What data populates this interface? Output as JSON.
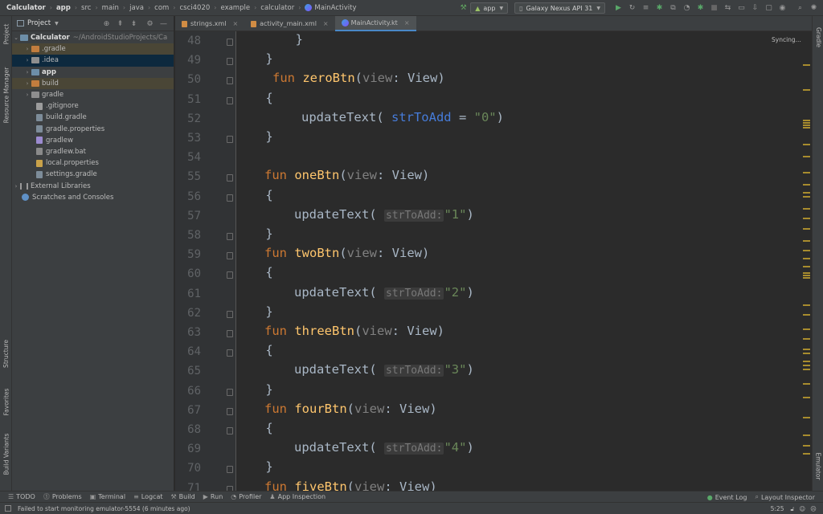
{
  "breadcrumbs": [
    "Calculator",
    "app",
    "src",
    "main",
    "java",
    "com",
    "csci4020",
    "example",
    "calculator",
    "MainActivity"
  ],
  "toolbar": {
    "run_config": "app",
    "device": "Galaxy Nexus API 31"
  },
  "left_tool_tabs": [
    "Project",
    "Resource Manager",
    "Structure",
    "Favorites",
    "Build Variants"
  ],
  "right_tool_tabs": [
    "Gradle",
    "Emulator"
  ],
  "project_panel": {
    "title": "Project",
    "root_name": "Calculator",
    "root_path": "~/AndroidStudioProjects/Ca",
    "items": [
      {
        "label": ".gradle"
      },
      {
        "label": ".idea"
      },
      {
        "label": "app"
      },
      {
        "label": "build"
      },
      {
        "label": "gradle"
      },
      {
        "label": ".gitignore"
      },
      {
        "label": "build.gradle"
      },
      {
        "label": "gradle.properties"
      },
      {
        "label": "gradlew"
      },
      {
        "label": "gradlew.bat"
      },
      {
        "label": "local.properties"
      },
      {
        "label": "settings.gradle"
      },
      {
        "label": "External Libraries"
      },
      {
        "label": "Scratches and Consoles"
      }
    ]
  },
  "editor_tabs": [
    {
      "label": "strings.xml"
    },
    {
      "label": "activity_main.xml"
    },
    {
      "label": "MainActivity.kt"
    }
  ],
  "editor_status": "Syncing...",
  "code_lines": [
    {
      "n": "48",
      "text": "        }"
    },
    {
      "n": "49",
      "text": "    }"
    },
    {
      "n": "50",
      "kw": "fun",
      "fn": "zeroBtn",
      "param": "view",
      "type": "View"
    },
    {
      "n": "51",
      "text": "    {"
    },
    {
      "n": "52",
      "call": "updateText(",
      "named": "strToAdd",
      "eq": " = ",
      "str": "\"0\"",
      "close": ")"
    },
    {
      "n": "53",
      "text": "    }"
    },
    {
      "n": "54",
      "text": ""
    },
    {
      "n": "55",
      "kw": "fun",
      "fn": "oneBtn",
      "param": "view",
      "type": "View"
    },
    {
      "n": "56",
      "text": "    {"
    },
    {
      "n": "57",
      "call": "updateText(",
      "hint": "strToAdd:",
      "str": "\"1\"",
      "close": ")"
    },
    {
      "n": "58",
      "text": "    }"
    },
    {
      "n": "59",
      "kw": "fun",
      "fn": "twoBtn",
      "param": "view",
      "type": "View"
    },
    {
      "n": "60",
      "text": "    {"
    },
    {
      "n": "61",
      "call": "updateText(",
      "hint": "strToAdd:",
      "str": "\"2\"",
      "close": ")"
    },
    {
      "n": "62",
      "text": "    }"
    },
    {
      "n": "63",
      "kw": "fun",
      "fn": "threeBtn",
      "param": "view",
      "type": "View"
    },
    {
      "n": "64",
      "text": "    {"
    },
    {
      "n": "65",
      "call": "updateText(",
      "hint": "strToAdd:",
      "str": "\"3\"",
      "close": ")"
    },
    {
      "n": "66",
      "text": "    }"
    },
    {
      "n": "67",
      "kw": "fun",
      "fn": "fourBtn",
      "param": "view",
      "type": "View"
    },
    {
      "n": "68",
      "text": "    {"
    },
    {
      "n": "69",
      "call": "updateText(",
      "hint": "strToAdd:",
      "str": "\"4\"",
      "close": ")"
    },
    {
      "n": "70",
      "text": "    }"
    },
    {
      "n": "71",
      "kw": "fun",
      "fn": "fiveBtn",
      "param": "view",
      "type": "View"
    }
  ],
  "bottom_tools": [
    "TODO",
    "Problems",
    "Terminal",
    "Logcat",
    "Build",
    "Run",
    "Profiler",
    "App Inspection"
  ],
  "bottom_right_tools": [
    "Event Log",
    "Layout Inspector"
  ],
  "status": {
    "message": "Failed to start monitoring emulator-5554 (6 minutes ago)",
    "position": "5:25"
  },
  "colors": {
    "keyword": "#cc7832",
    "function": "#ffc66d",
    "string": "#6a8759",
    "selection": "#0d293e",
    "accent": "#4a88c7"
  }
}
